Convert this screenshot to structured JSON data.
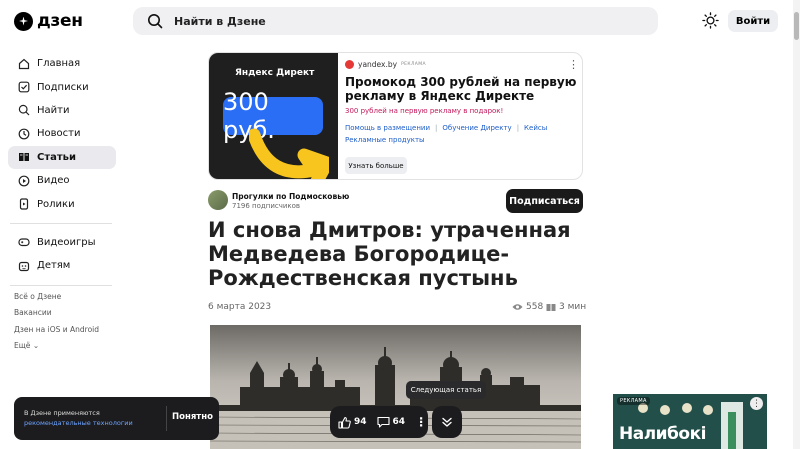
{
  "header": {
    "logo_text": "дзен",
    "search_placeholder": "Найти в Дзене",
    "login_label": "Войти"
  },
  "sidebar": {
    "items": [
      {
        "label": "Главная",
        "icon": "home-icon"
      },
      {
        "label": "Подписки",
        "icon": "subscriptions-icon"
      },
      {
        "label": "Найти",
        "icon": "search-icon"
      },
      {
        "label": "Новости",
        "icon": "news-icon"
      },
      {
        "label": "Статьи",
        "icon": "articles-icon",
        "active": true
      },
      {
        "label": "Видео",
        "icon": "video-icon"
      },
      {
        "label": "Ролики",
        "icon": "shorts-icon"
      }
    ],
    "extra_items": [
      {
        "label": "Видеоигры",
        "icon": "gamepad-icon"
      },
      {
        "label": "Детям",
        "icon": "kids-icon"
      }
    ],
    "footer_links": [
      "Всё о Дзене",
      "Вакансии",
      "Дзен на iOS и Android",
      "Ещё"
    ]
  },
  "ad": {
    "image_brand": "Яндекс Директ",
    "image_price": "300 руб.",
    "source": "yandex.by",
    "tag": "РЕКЛАМА",
    "title": "Промокод 300 рублей на первую рекламу в Яндекс Директе",
    "subtitle": "300 рублей на первую рекламу в подарок!",
    "links": [
      "Помощь в размещении",
      "Обучение Директу",
      "Кейсы",
      "Рекламные продукты"
    ],
    "button": "Узнать больше"
  },
  "channel": {
    "name": "Прогулки по Подмосковью",
    "subscribers": "7196 подписчиков",
    "subscribe_label": "Подписаться"
  },
  "article": {
    "title": "И снова Дмитров: утраченная Медведева Богородице-Рождественская пустынь",
    "date": "6 марта 2023",
    "views": "558",
    "read_time": "3 мин"
  },
  "toast": {
    "text": "В Дзене применяются",
    "link": "рекомендательные технологии",
    "button": "Понятно"
  },
  "actions": {
    "likes": "94",
    "comments": "64",
    "next_tooltip": "Следующая статья"
  },
  "side_ad": {
    "tag": "РЕКЛАМА",
    "title": "Налибокі"
  },
  "colors": {
    "accent_blue": "#1e5ec8",
    "ad_pink": "#c2185b",
    "dark": "#1c1c1e"
  }
}
